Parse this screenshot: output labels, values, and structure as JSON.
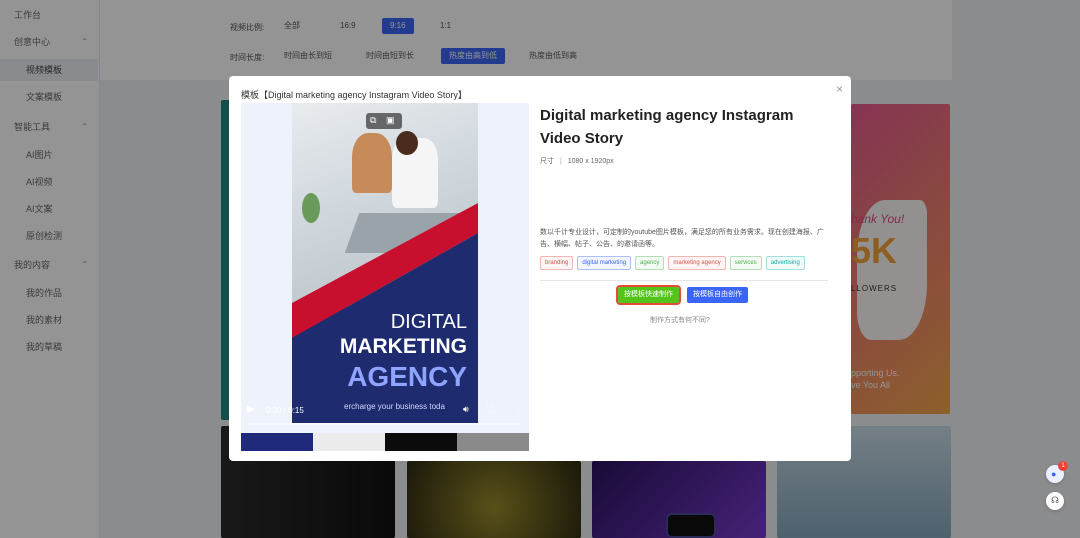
{
  "sidebar": {
    "top_item": "工作台",
    "sections": [
      {
        "label": "创意中心",
        "items": [
          "视频模板",
          "文案模板"
        ]
      },
      {
        "label": "智能工具",
        "items": [
          "AI图片",
          "AI视频",
          "AI文案",
          "原创检测"
        ]
      },
      {
        "label": "我的内容",
        "items": [
          "我的作品",
          "我的素材",
          "我的草稿"
        ]
      }
    ]
  },
  "filters": {
    "ratio_label": "视频比例:",
    "ratio_options": [
      "全部",
      "16:9",
      "9:16",
      "1:1"
    ],
    "ratio_selected": "9:16",
    "duration_label": "时间长度:",
    "duration_options": [
      "时间由长到短",
      "时间由短到长",
      "热度由高到低",
      "热度由低到高"
    ],
    "duration_selected": "热度由高到低"
  },
  "modal": {
    "title": "模板【Digital marketing agency Instagram Video Story】",
    "close_icon": "close-icon",
    "video": {
      "headline_1": "DIGITAL",
      "headline_2": "MARKETING",
      "headline_3": "AGENCY",
      "tagline": "ercharge your business toda",
      "time": "0:00 / 0:15",
      "progress": 0.0,
      "swatches": [
        "#1f2a7a",
        "#ececec",
        "#0b0b0b",
        "#8a8a8a"
      ]
    },
    "info": {
      "title": "Digital marketing agency Instagram Video Story",
      "size_label": "尺寸",
      "size_value": "1080 x 1920px",
      "description": "数以千计专业设计，可定制的youtube图片模板，满足您的所有业务需求。现在创建海报、广告、横幅、帖子、公告、的邀请函等。",
      "tags": [
        "branding",
        "digital marketing",
        "agency",
        "marketing agency",
        "services",
        "advertising"
      ],
      "primary_button": "按模板快速制作",
      "secondary_button": "按模板自由创作",
      "difference_link": "制作方式有何不同?"
    }
  },
  "background": {
    "card_text_1": "hank You!",
    "card_text_2": "5K",
    "card_text_3": "LLOWERS",
    "card_text_4": "pporting Us.",
    "card_text_5": "ve You All"
  },
  "floating": {
    "badge": "1"
  }
}
